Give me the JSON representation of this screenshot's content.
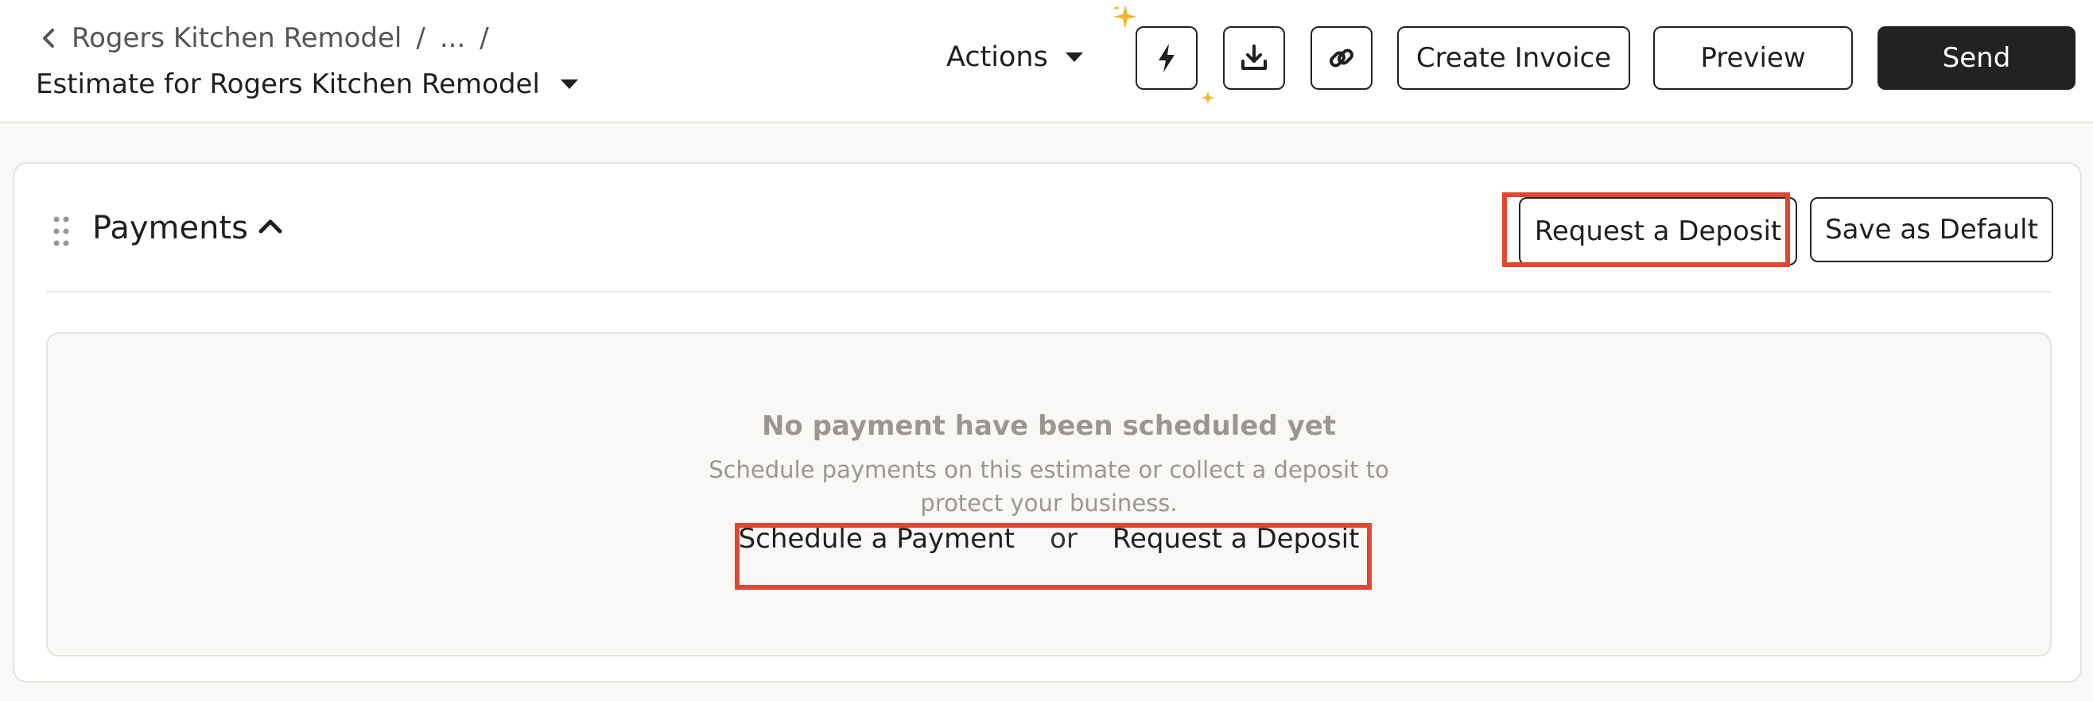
{
  "header": {
    "breadcrumb": {
      "project": "Rogers Kitchen Remodel",
      "ellipsis": "...",
      "separator": "/"
    },
    "title": "Estimate for Rogers Kitchen Remodel",
    "actions_label": "Actions",
    "buttons": {
      "create_invoice": "Create Invoice",
      "preview": "Preview",
      "send": "Send"
    },
    "icons": [
      "lightning-icon",
      "download-icon",
      "link-icon"
    ]
  },
  "payments": {
    "title": "Payments",
    "request_deposit_label": "Request a Deposit",
    "save_default_label": "Save as Default",
    "empty": {
      "title": "No payment have been scheduled yet",
      "description": "Schedule payments on this estimate or collect a deposit to protect your business.",
      "schedule_label": "Schedule a Payment",
      "or_label": "or",
      "deposit_label": "Request a Deposit"
    }
  },
  "colors": {
    "accent_dark": "#222222",
    "highlight": "#e04630",
    "sparkle": "#f2b830",
    "muted_text": "#9a978e"
  }
}
